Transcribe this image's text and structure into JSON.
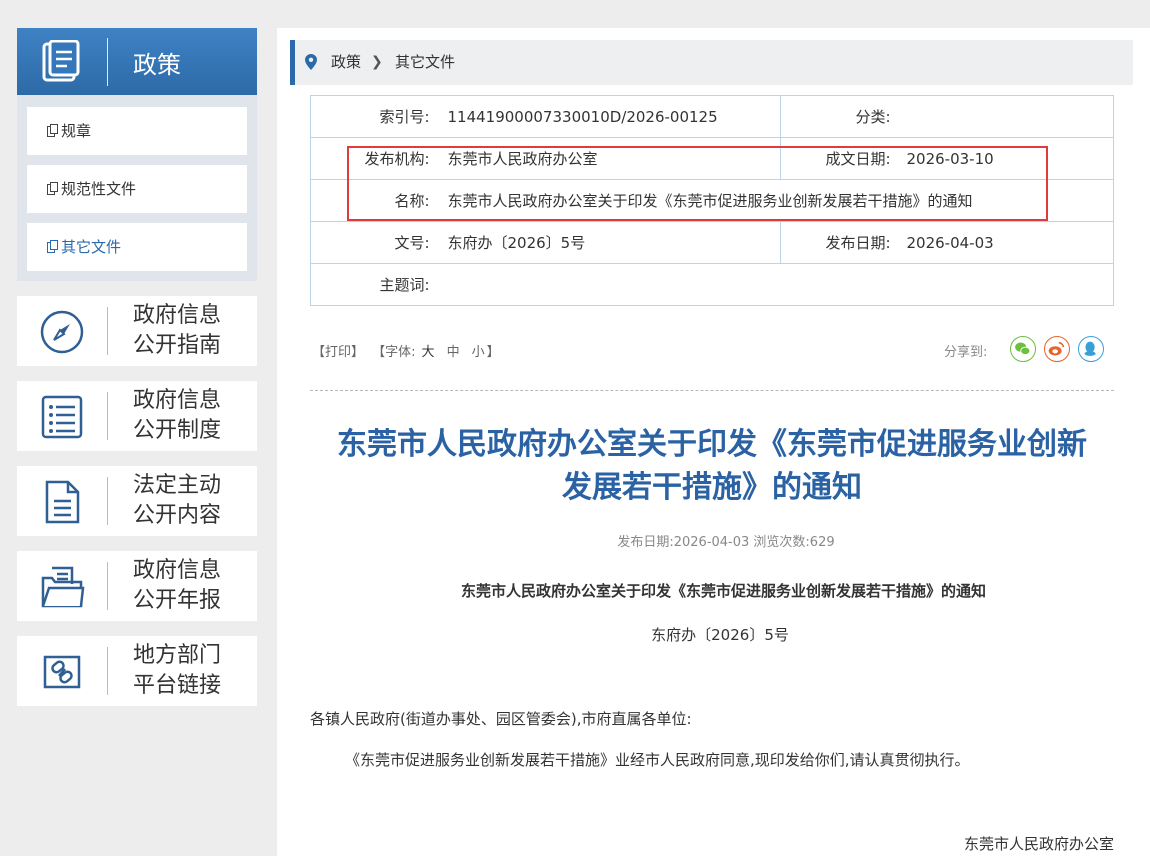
{
  "sidebar": {
    "policy_title": "政策",
    "policy_items": [
      {
        "label": "规章"
      },
      {
        "label": "规范性文件"
      },
      {
        "label": "其它文件"
      }
    ],
    "nav": [
      {
        "line1": "政府信息",
        "line2": "公开指南",
        "icon": "compass-icon"
      },
      {
        "line1": "政府信息",
        "line2": "公开制度",
        "icon": "list-icon"
      },
      {
        "line1": "法定主动",
        "line2": "公开内容",
        "icon": "document-icon"
      },
      {
        "line1": "政府信息",
        "line2": "公开年报",
        "icon": "folder-icon"
      },
      {
        "line1": "地方部门",
        "line2": "平台链接",
        "icon": "link-icon"
      }
    ]
  },
  "breadcrumb": {
    "level1": "政策",
    "level2": "其它文件"
  },
  "info": {
    "index_label": "索引号:",
    "index_value": "11441900007330010D/2026-00125",
    "category_label": "分类:",
    "category_value": "",
    "publisher_label": "发布机构:",
    "publisher_value": "东莞市人民政府办公室",
    "date_label": "成文日期:",
    "date_value": "2026-03-10",
    "name_label": "名称:",
    "name_value": "东莞市人民政府办公室关于印发《东莞市促进服务业创新发展若干措施》的通知",
    "docno_label": "文号:",
    "docno_value": "东府办〔2026〕5号",
    "pubdate_label": "发布日期:",
    "pubdate_value": "2026-04-03",
    "keyword_label": "主题词:",
    "keyword_value": ""
  },
  "tools": {
    "print": "【打印】",
    "font_prefix": "【字体:",
    "font_large": "大",
    "font_medium": "中",
    "font_small": "小",
    "font_suffix": "】",
    "share_label": "分享到:"
  },
  "article": {
    "title_line1": "东莞市人民政府办公室关于印发《东莞市促进服务业创新",
    "title_line2": "发展若干措施》的通知",
    "meta": "发布日期:2026-04-03  浏览次数:629",
    "subtitle": "东莞市人民政府办公室关于印发《东莞市促进服务业创新发展若干措施》的通知",
    "docno": "东府办〔2026〕5号",
    "para1": "各镇人民政府(街道办事处、园区管委会),市府直属各单位:",
    "para2": "《东莞市促进服务业创新发展若干措施》业经市人民政府同意,现印发给你们,请认真贯彻执行。",
    "signature": "东莞市人民政府办公室"
  },
  "colors": {
    "brand": "#2a6aaa",
    "title": "#2a62a4",
    "highlight": "#e03b3b",
    "wechat": "#6cbf3f",
    "weibo": "#e8622b",
    "qq": "#3a9fd8"
  }
}
